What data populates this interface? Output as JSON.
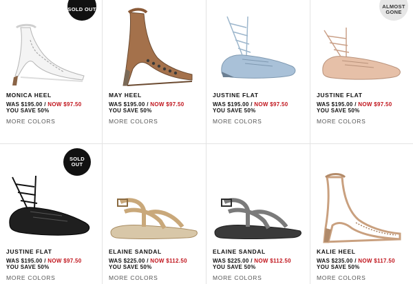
{
  "common": {
    "was_prefix": "WAS ",
    "now_prefix": "NOW ",
    "separator": " / ",
    "save_label": "YOU SAVE 50%",
    "more_colors": "MORE COLORS"
  },
  "products": [
    {
      "name": "MONICA HEEL",
      "was": "$195.00",
      "now": "$97.50",
      "badge": "SOLD OUT",
      "icon": "ankle-strap-heel-icon",
      "color": "#f2f2f2"
    },
    {
      "name": "MAY HEEL",
      "was": "$195.00",
      "now": "$97.50",
      "badge": "",
      "icon": "studded-heel-icon",
      "color": "#9a6a45"
    },
    {
      "name": "JUSTINE FLAT",
      "was": "$195.00",
      "now": "$97.50",
      "badge": "",
      "icon": "lace-up-flat-icon",
      "color": "#a9c1d8"
    },
    {
      "name": "JUSTINE FLAT",
      "was": "$195.00",
      "now": "$97.50",
      "badge": "ALMOST GONE",
      "icon": "lace-up-flat-icon",
      "color": "#e2b9a0"
    },
    {
      "name": "JUSTINE FLAT",
      "was": "$195.00",
      "now": "$97.50",
      "badge": "SOLD OUT",
      "icon": "lace-up-flat-icon",
      "color": "#1a1a1a"
    },
    {
      "name": "ELAINE SANDAL",
      "was": "$225.00",
      "now": "$112.50",
      "badge": "",
      "icon": "flat-sandal-icon",
      "color": "#c9a87a"
    },
    {
      "name": "ELAINE SANDAL",
      "was": "$225.00",
      "now": "$112.50",
      "badge": "",
      "icon": "flat-sandal-icon",
      "color": "#6a6a6a"
    },
    {
      "name": "KALIE HEEL",
      "was": "$235.00",
      "now": "$117.50",
      "badge": "",
      "icon": "strappy-heel-icon",
      "color": "#c9a07f"
    }
  ]
}
